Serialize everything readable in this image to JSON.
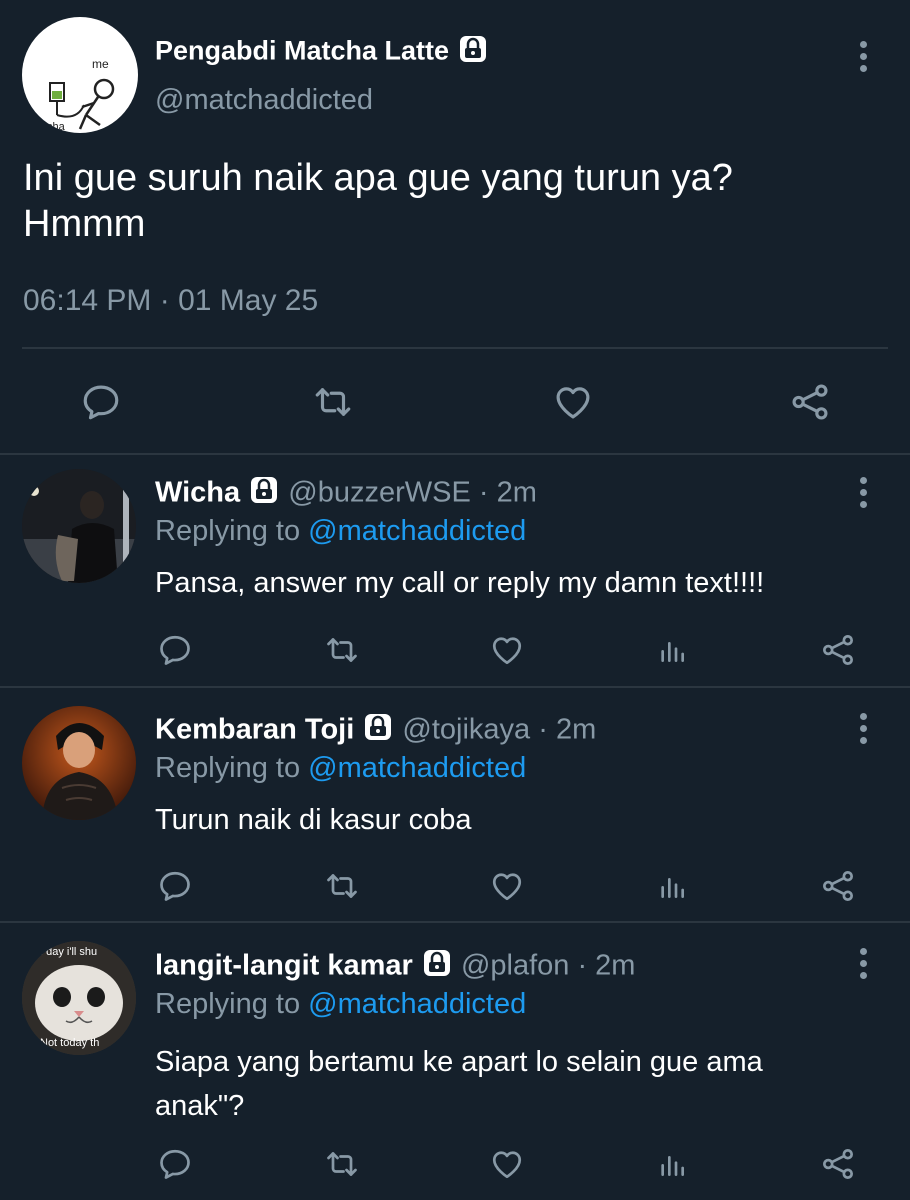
{
  "main_tweet": {
    "display_name": "Pengabdi Matcha Latte",
    "handle": "@matchaddicted",
    "text_line1": "Ini gue suruh naik apa gue yang turun ya?",
    "text_line2": "Hmmm",
    "timestamp": "06:14 PM · 01 May 25",
    "avatar_labels": [
      "me",
      "tcha"
    ]
  },
  "replies": [
    {
      "display_name": "Wicha",
      "handle": "@buzzerWSE",
      "time": "· 2m",
      "replying_prefix": "Replying to",
      "replying_to": "@matchaddicted",
      "text": "Pansa, answer my call or reply my damn text!!!!"
    },
    {
      "display_name": "Kembaran Toji",
      "handle": "@tojikaya",
      "time": "· 2m",
      "replying_prefix": "Replying to",
      "replying_to": "@matchaddicted",
      "text": "Turun naik di kasur coba"
    },
    {
      "display_name": "langit-langit kamar",
      "handle": "@plafon",
      "time": "· 2m",
      "replying_prefix": "Replying to",
      "replying_to": "@matchaddicted",
      "text_line1": "Siapa yang bertamu ke apart lo selain gue ama",
      "text_line2": "anak\"?",
      "avatar_text_top": ". day i'll shu",
      "avatar_text_bottom": "Not today th"
    }
  ],
  "colors": {
    "background": "#15202b",
    "muted": "#8899a6",
    "link": "#1d9bf0",
    "divider": "#2b3640"
  },
  "icons": [
    "lock-icon",
    "more-icon",
    "reply-icon",
    "retweet-icon",
    "like-icon",
    "analytics-icon",
    "share-icon"
  ]
}
